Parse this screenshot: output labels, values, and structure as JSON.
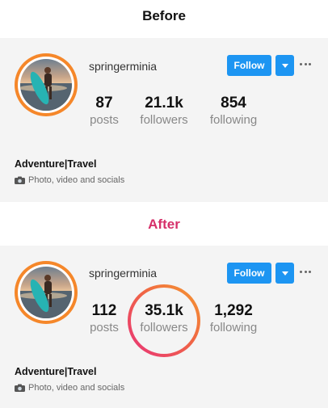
{
  "before": {
    "heading": "Before",
    "profile": {
      "username": "springerminia",
      "follow_label": "Follow",
      "stats": [
        {
          "value": "87",
          "label": "posts"
        },
        {
          "value": "21.1k",
          "label": "followers"
        },
        {
          "value": "854",
          "label": "following"
        }
      ],
      "bio_name": "Adventure|Travel",
      "bio_text": "Photo, video and socials"
    }
  },
  "after": {
    "heading": "After",
    "profile": {
      "username": "springerminia",
      "follow_label": "Follow",
      "stats": [
        {
          "value": "112",
          "label": "posts"
        },
        {
          "value": "35.1k",
          "label": "followers"
        },
        {
          "value": "1,292",
          "label": "following"
        }
      ],
      "bio_name": "Adventure|Travel",
      "bio_text": "Photo, video and socials"
    }
  },
  "colors": {
    "follow_button": "#1d95f2",
    "after_heading": "#d6306a",
    "avatar_ring": "#f5872a",
    "highlight_ring_gradient": [
      "#e8327a",
      "#f06545",
      "#f59a2e"
    ]
  },
  "icons": [
    "chevron-down-icon",
    "more-options-icon",
    "camera-icon"
  ]
}
